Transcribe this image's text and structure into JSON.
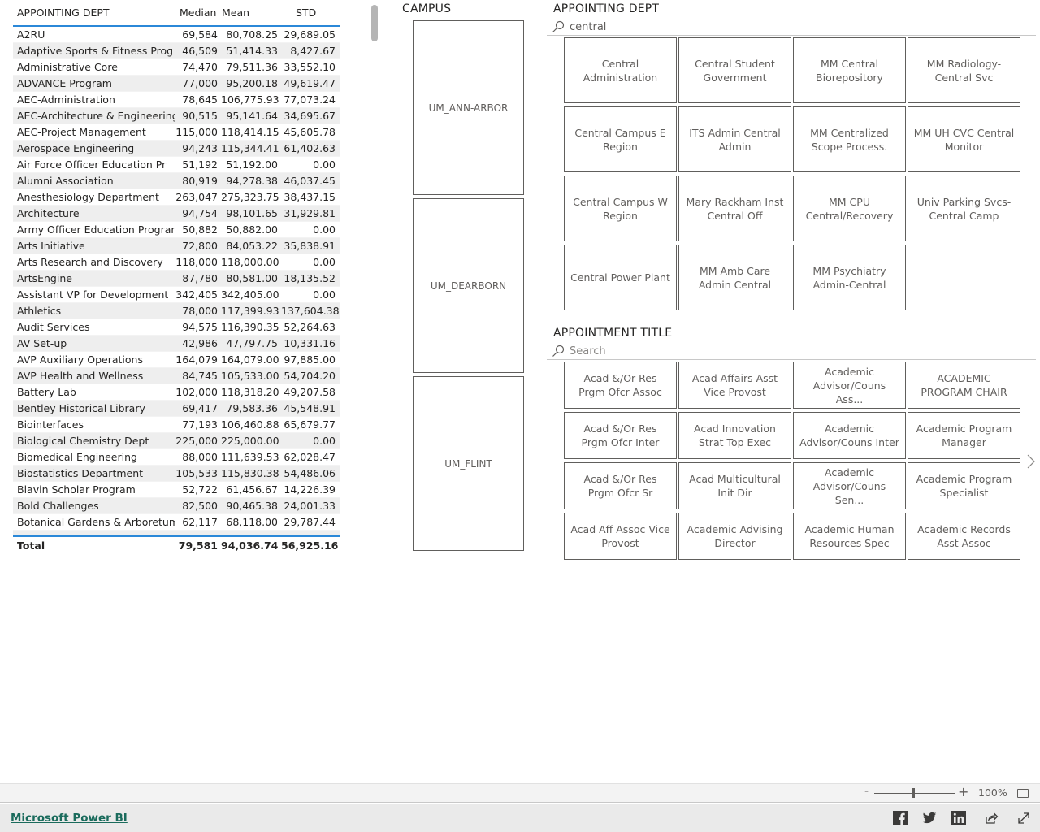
{
  "table": {
    "headers": {
      "name": "APPOINTING DEPT",
      "median": "Median",
      "mean": "Mean",
      "std": "STD"
    },
    "rows": [
      {
        "name": "A2RU",
        "median": "69,584",
        "mean": "80,708.25",
        "std": "29,689.05"
      },
      {
        "name": "Adaptive Sports & Fitness Prog",
        "median": "46,509",
        "mean": "51,414.33",
        "std": "8,427.67"
      },
      {
        "name": "Administrative Core",
        "median": "74,470",
        "mean": "79,511.36",
        "std": "33,552.10"
      },
      {
        "name": "ADVANCE Program",
        "median": "77,000",
        "mean": "95,200.18",
        "std": "49,619.47"
      },
      {
        "name": "AEC-Administration",
        "median": "78,645",
        "mean": "106,775.93",
        "std": "77,073.24"
      },
      {
        "name": "AEC-Architecture & Engineering",
        "median": "90,515",
        "mean": "95,141.64",
        "std": "34,695.67"
      },
      {
        "name": "AEC-Project Management",
        "median": "115,000",
        "mean": "118,414.15",
        "std": "45,605.78"
      },
      {
        "name": "Aerospace Engineering",
        "median": "94,243",
        "mean": "115,344.41",
        "std": "61,402.63"
      },
      {
        "name": "Air Force Officer Education Pr",
        "median": "51,192",
        "mean": "51,192.00",
        "std": "0.00"
      },
      {
        "name": "Alumni Association",
        "median": "80,919",
        "mean": "94,278.38",
        "std": "46,037.45"
      },
      {
        "name": "Anesthesiology Department",
        "median": "263,047",
        "mean": "275,323.75",
        "std": "38,437.15"
      },
      {
        "name": "Architecture",
        "median": "94,754",
        "mean": "98,101.65",
        "std": "31,929.81"
      },
      {
        "name": "Army Officer Education Program",
        "median": "50,882",
        "mean": "50,882.00",
        "std": "0.00"
      },
      {
        "name": "Arts Initiative",
        "median": "72,800",
        "mean": "84,053.22",
        "std": "35,838.91"
      },
      {
        "name": "Arts Research and Discovery",
        "median": "118,000",
        "mean": "118,000.00",
        "std": "0.00"
      },
      {
        "name": "ArtsEngine",
        "median": "87,780",
        "mean": "80,581.00",
        "std": "18,135.52"
      },
      {
        "name": "Assistant VP for Development",
        "median": "342,405",
        "mean": "342,405.00",
        "std": "0.00"
      },
      {
        "name": "Athletics",
        "median": "78,000",
        "mean": "117,399.93",
        "std": "137,604.38"
      },
      {
        "name": "Audit Services",
        "median": "94,575",
        "mean": "116,390.35",
        "std": "52,264.63"
      },
      {
        "name": "AV Set-up",
        "median": "42,986",
        "mean": "47,797.75",
        "std": "10,331.16"
      },
      {
        "name": "AVP Auxiliary Operations",
        "median": "164,079",
        "mean": "164,079.00",
        "std": "97,885.00"
      },
      {
        "name": "AVP Health and Wellness",
        "median": "84,745",
        "mean": "105,533.00",
        "std": "54,704.20"
      },
      {
        "name": "Battery Lab",
        "median": "102,000",
        "mean": "118,318.20",
        "std": "49,207.58"
      },
      {
        "name": "Bentley Historical Library",
        "median": "69,417",
        "mean": "79,583.36",
        "std": "45,548.91"
      },
      {
        "name": "Biointerfaces",
        "median": "77,193",
        "mean": "106,460.88",
        "std": "65,679.77"
      },
      {
        "name": "Biological Chemistry Dept",
        "median": "225,000",
        "mean": "225,000.00",
        "std": "0.00"
      },
      {
        "name": "Biomedical Engineering",
        "median": "88,000",
        "mean": "111,639.53",
        "std": "62,028.47"
      },
      {
        "name": "Biostatistics Department",
        "median": "105,533",
        "mean": "115,830.38",
        "std": "54,486.06"
      },
      {
        "name": "Blavin Scholar Program",
        "median": "52,722",
        "mean": "61,456.67",
        "std": "14,226.39"
      },
      {
        "name": "Bold Challenges",
        "median": "82,500",
        "mean": "90,465.38",
        "std": "24,001.33"
      },
      {
        "name": "Botanical Gardens & Arboretum",
        "median": "62,117",
        "mean": "68,118.00",
        "std": "29,787.44"
      }
    ],
    "total": {
      "name": "Total",
      "median": "79,581",
      "mean": "94,036.74",
      "std": "56,925.16"
    }
  },
  "campus_slicer": {
    "title": "CAMPUS",
    "items": [
      "UM_ANN-ARBOR",
      "UM_DEARBORN",
      "UM_FLINT"
    ]
  },
  "dept_slicer": {
    "title": "APPOINTING DEPT",
    "search_value": "central",
    "search_placeholder": "Search",
    "items": [
      "Central Administration",
      "Central Student Government",
      "MM Central Biorepository",
      "MM Radiology-Central Svc",
      "Central Campus E Region",
      "ITS Admin Central Admin",
      "MM Centralized Scope Process.",
      "MM UH CVC Central Monitor",
      "Central Campus W Region",
      "Mary Rackham Inst Central Off",
      "MM CPU Central/Recovery",
      "Univ Parking Svcs-Central Camp",
      "Central Power Plant",
      "MM Amb Care Admin Central",
      "MM Psychiatry Admin-Central"
    ]
  },
  "appt_slicer": {
    "title": "APPOINTMENT TITLE",
    "search_value": "",
    "search_placeholder": "Search",
    "items": [
      "Acad &/Or Res Prgm Ofcr Assoc",
      "Acad Affairs Asst Vice Provost",
      "Academic Advisor/Couns Ass...",
      "ACADEMIC PROGRAM CHAIR",
      "Acad &/Or Res Prgm Ofcr Inter",
      "Acad Innovation Strat Top Exec",
      "Academic Advisor/Couns Inter",
      "Academic Program Manager",
      "Acad &/Or Res Prgm Ofcr Sr",
      "Acad Multicultural Init Dir",
      "Academic Advisor/Couns Sen...",
      "Academic Program Specialist",
      "Acad Aff Assoc Vice Provost",
      "Academic Advising Director",
      "Academic Human Resources Spec",
      "Academic Records Asst Assoc"
    ]
  },
  "zoom": {
    "minus": "-",
    "plus": "+",
    "level": "100%",
    "value_percent": 100
  },
  "footer": {
    "brand_link": "Microsoft Power BI"
  },
  "colors": {
    "accent": "#2b88d8",
    "link": "#1a6b5c",
    "tile_border": "#605e5c"
  }
}
